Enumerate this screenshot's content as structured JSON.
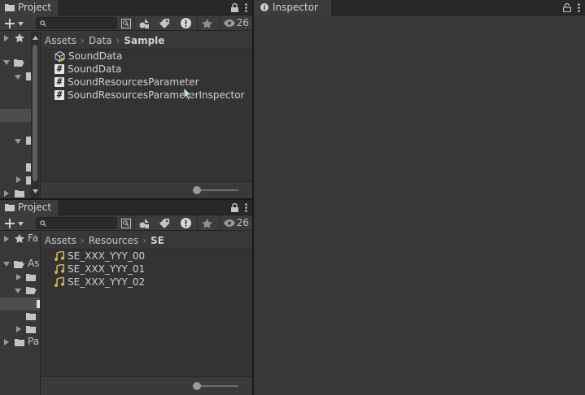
{
  "top_panel": {
    "tab_label": "Project",
    "count": "26",
    "breadcrumb": [
      "Assets",
      "Data",
      "Sample"
    ],
    "files": [
      {
        "icon": "scriptable-object-icon",
        "label": "SoundData"
      },
      {
        "icon": "script-hash-icon",
        "label": "SoundData"
      },
      {
        "icon": "script-hash-icon",
        "label": "SoundResourcesParameter"
      },
      {
        "icon": "script-hash-icon",
        "label": "SoundResourcesParameterInspector"
      }
    ]
  },
  "bottom_panel": {
    "tab_label": "Project",
    "count": "26",
    "breadcrumb": [
      "Assets",
      "Resources",
      "SE"
    ],
    "tree": [
      "Fa",
      "As",
      "Pa"
    ],
    "files": [
      {
        "icon": "audio-clip-icon",
        "label": "SE_XXX_YYY_00"
      },
      {
        "icon": "audio-clip-icon",
        "label": "SE_XXX_YYY_01"
      },
      {
        "icon": "audio-clip-icon",
        "label": "SE_XXX_YYY_02"
      }
    ]
  },
  "inspector": {
    "tab_label": "Inspector"
  },
  "colors": {
    "panel_bg": "#383838",
    "content_bg": "#333333",
    "tab_active": "#3c3c3c",
    "audio_icon": "#d8b23a",
    "selection": "#4d4d4d"
  }
}
